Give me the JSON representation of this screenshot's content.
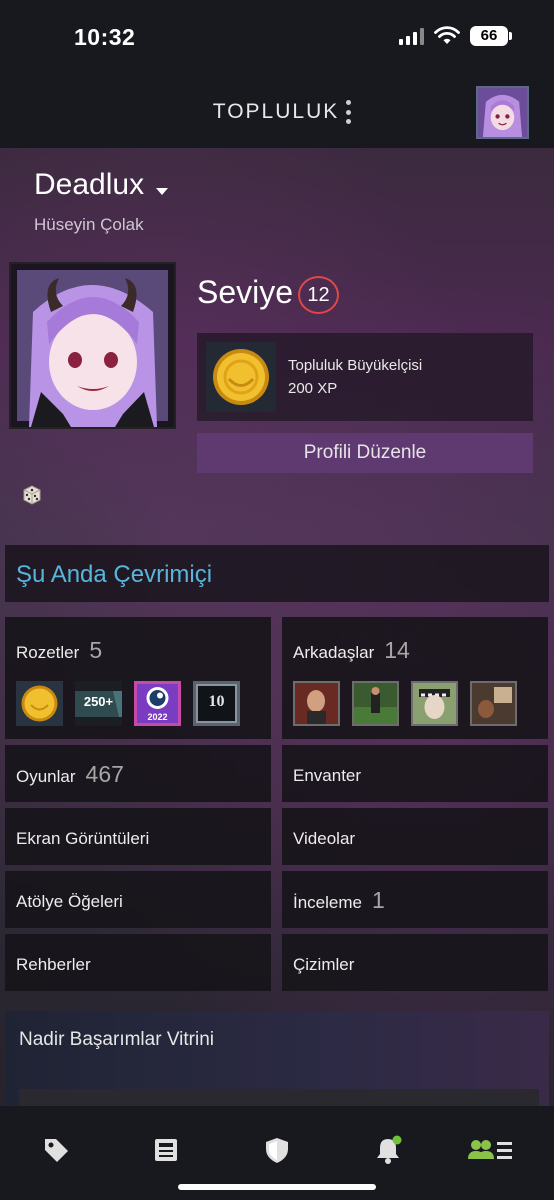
{
  "status_bar": {
    "time": "10:32",
    "battery": "66"
  },
  "nav": {
    "title": "TOPLULUK"
  },
  "profile": {
    "username": "Deadlux",
    "real_name": "Hüseyin Çolak",
    "level_label": "Seviye",
    "level": "12",
    "featured_badge": {
      "name": "Topluluk Büyükelçisi",
      "xp": "200 XP"
    },
    "edit_button": "Profili Düzenle",
    "online_status": "Şu Anda Çevrimiçi"
  },
  "stats": {
    "badges": {
      "label": "Rozetler",
      "count": "5",
      "items": [
        "community-ambassador-badge",
        "250-plus-badge",
        "steam-2022-badge",
        "years-of-service-10-badge"
      ],
      "years_label": "10",
      "plus_label": "250+",
      "year_label": "2022"
    },
    "friends": {
      "label": "Arkadaşlar",
      "count": "14"
    },
    "games": {
      "label": "Oyunlar",
      "count": "467"
    },
    "inventory": {
      "label": "Envanter"
    },
    "screenshots": {
      "label": "Ekran Görüntüleri"
    },
    "videos": {
      "label": "Videolar"
    },
    "workshop": {
      "label": "Atölye Öğeleri"
    },
    "reviews": {
      "label": "İnceleme",
      "count": "1"
    },
    "guides": {
      "label": "Rehberler"
    },
    "artwork": {
      "label": "Çizimler"
    }
  },
  "showcase": {
    "title": "Nadir Başarımlar Vitrini"
  },
  "tabbar": [
    "store-tag-icon",
    "news-icon",
    "shield-icon",
    "bell-icon",
    "community-icon"
  ],
  "colors": {
    "accent_blue": "#58b6dc",
    "level_ring": "#e04848",
    "edit_button": "#5e3a70",
    "active_tab": "#8bc34a"
  }
}
